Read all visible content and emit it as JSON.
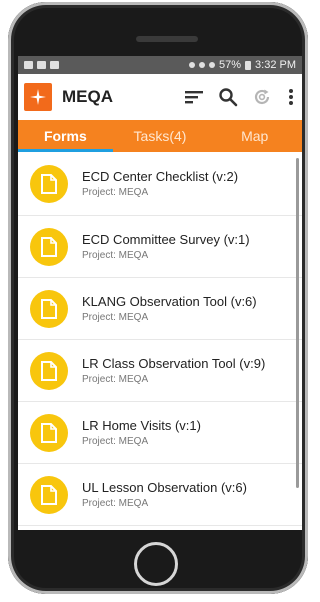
{
  "status_bar": {
    "battery": "57%",
    "time": "3:32 PM"
  },
  "app_bar": {
    "title": "MEQA",
    "icons": [
      "sort-icon",
      "search-icon",
      "sync-icon",
      "more-vert-icon"
    ]
  },
  "tabs": [
    {
      "label": "Forms",
      "active": true
    },
    {
      "label": "Tasks(4)",
      "active": false
    },
    {
      "label": "Map",
      "active": false
    }
  ],
  "forms": [
    {
      "name": "ECD Center Checklist (v:2)",
      "project": "Project: MEQA"
    },
    {
      "name": "ECD Committee Survey (v:1)",
      "project": "Project: MEQA"
    },
    {
      "name": "KLANG Observation Tool (v:6)",
      "project": "Project: MEQA"
    },
    {
      "name": "LR Class Observation Tool (v:9)",
      "project": "Project: MEQA"
    },
    {
      "name": "LR Home Visits (v:1)",
      "project": "Project: MEQA"
    },
    {
      "name": "UL Lesson Observation (v:6)",
      "project": "Project: MEQA"
    }
  ],
  "colors": {
    "accent": "#f5821f",
    "logo": "#f26a1b",
    "form_icon": "#f8c60d",
    "tab_indicator": "#1f9fe0"
  }
}
